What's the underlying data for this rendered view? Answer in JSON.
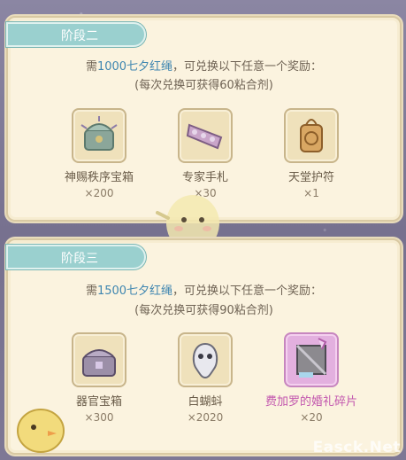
{
  "stages": [
    {
      "tab_label": "阶段二",
      "req_prefix": "需",
      "req_highlight": "1000七夕红绳",
      "req_suffix": "，可兑换以下任意一个奖励：",
      "note": "(每次兑换可获得60粘合剂)",
      "items": [
        {
          "name": "神赐秩序宝箱",
          "qty": "×200",
          "icon": "ornate-chest-icon"
        },
        {
          "name": "专家手札",
          "qty": "×30",
          "icon": "scroll-notes-icon"
        },
        {
          "name": "天堂护符",
          "qty": "×1",
          "icon": "amulet-icon"
        }
      ]
    },
    {
      "tab_label": "阶段三",
      "req_prefix": "需",
      "req_highlight": "1500七夕红绳",
      "req_suffix": "，可兑换以下任意一个奖励：",
      "note": "(每次兑换可获得90粘合剂)",
      "items": [
        {
          "name": "器官宝箱",
          "qty": "×300",
          "icon": "organ-chest-icon"
        },
        {
          "name": "白蝴蚪",
          "qty": "×2020",
          "icon": "white-tadpole-icon"
        },
        {
          "name": "费加罗的婚礼碎片",
          "qty": "×20",
          "icon": "figaro-wedding-shard-icon",
          "highlight": true
        }
      ]
    }
  ],
  "watermark": "Easck.Net",
  "colors": {
    "tab": "#9ad0cf",
    "panel": "#fbf3df",
    "highlight_text": "#3f86b0",
    "rare_name": "#c256ae"
  }
}
